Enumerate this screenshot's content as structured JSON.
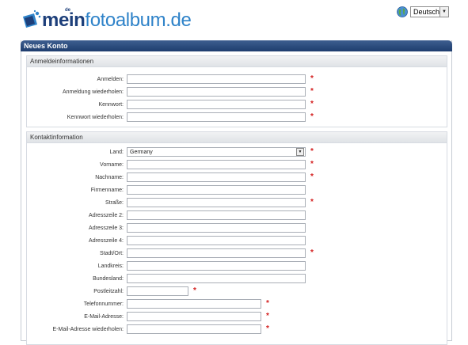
{
  "header": {
    "logo_text_bold": "mein",
    "logo_text_light": "fotoalbum",
    "logo_text_domain": ".de",
    "logo_superscript": "de"
  },
  "language": {
    "selected": "Deutsch",
    "icon": "globe-icon"
  },
  "panel": {
    "title": "Neues Konto"
  },
  "login_section": {
    "title": "Anmeldeinformationen",
    "fields": [
      {
        "label": "Anmelden:",
        "value": "",
        "required": true
      },
      {
        "label": "Anmeldung wiederholen:",
        "value": "",
        "required": true
      },
      {
        "label": "Kennwort:",
        "value": "",
        "required": true
      },
      {
        "label": "Kennwort wiederholen:",
        "value": "",
        "required": true
      }
    ]
  },
  "contact_section": {
    "title": "Kontaktinformation",
    "fields": [
      {
        "label": "Land:",
        "value": "Germany",
        "required": true
      },
      {
        "label": "Vorname:",
        "value": "",
        "required": true
      },
      {
        "label": "Nachname:",
        "value": "",
        "required": true
      },
      {
        "label": "Firmenname:",
        "value": "",
        "required": false
      },
      {
        "label": "Straße:",
        "value": "",
        "required": true
      },
      {
        "label": "Adresszeile 2:",
        "value": "",
        "required": false
      },
      {
        "label": "Adresszeile 3:",
        "value": "",
        "required": false
      },
      {
        "label": "Adresszeile 4:",
        "value": "",
        "required": false
      },
      {
        "label": "Stadt/Ort:",
        "value": "",
        "required": true
      },
      {
        "label": "Landkreis:",
        "value": "",
        "required": false
      },
      {
        "label": "Bundesland:",
        "value": "",
        "required": false
      },
      {
        "label": "Postleitzahl:",
        "value": "",
        "required": true
      },
      {
        "label": "Telefonnummer:",
        "value": "",
        "required": true
      },
      {
        "label": "E-Mail-Adresse:",
        "value": "",
        "required": true
      },
      {
        "label": "E-Mail-Adresse wiederholen:",
        "value": "",
        "required": true
      }
    ]
  },
  "required_marker": "*",
  "colors": {
    "brand_dark": "#1d3f7a",
    "brand_light": "#2f83c9",
    "header_bar": "#1e3d6e",
    "required": "#d42020"
  }
}
